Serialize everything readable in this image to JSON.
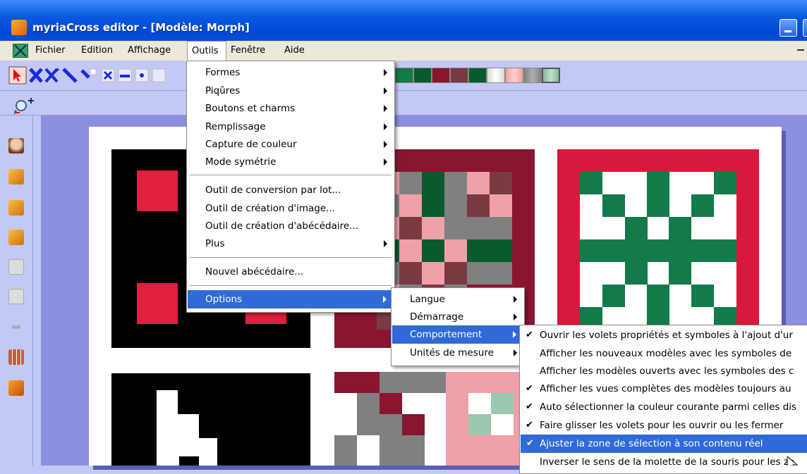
{
  "window": {
    "title": "myriaCross editor - [Modèle: Morph]"
  },
  "menubar": {
    "items": [
      "Fichier",
      "Edition",
      "Affichage",
      "Outils",
      "Fenêtre",
      "Aide"
    ]
  },
  "colors": {
    "title_bar": "#0a5ae0",
    "menu_highlight": "#2f6ad6",
    "workspace": "#8a8fe0",
    "palette": [
      "#f0f0f0",
      "#137a4a",
      "#d8183c",
      "#0a5a30",
      "#8a1530",
      "#7a3a44",
      "#0a5a30",
      "#d8d8d8",
      "#f0a0a0",
      "#808080",
      "#80b898"
    ]
  },
  "outils_menu": {
    "groups": [
      [
        {
          "label": "Formes",
          "submenu": true
        },
        {
          "label": "Piqûres",
          "submenu": true
        },
        {
          "label": "Boutons et charms",
          "submenu": true
        },
        {
          "label": "Remplissage",
          "submenu": true
        },
        {
          "label": "Capture de couleur",
          "submenu": true
        },
        {
          "label": "Mode symétrie",
          "submenu": true
        }
      ],
      [
        {
          "label": "Outil de conversion par lot...",
          "submenu": false
        },
        {
          "label": "Outil de création d'image...",
          "submenu": false
        },
        {
          "label": "Outil de création d'abécédaire...",
          "submenu": false
        },
        {
          "label": "Plus",
          "submenu": true
        }
      ],
      [
        {
          "label": "Nouvel abécédaire...",
          "submenu": false
        }
      ],
      [
        {
          "label": "Options",
          "submenu": true,
          "highlighted": true
        }
      ]
    ]
  },
  "options_menu": {
    "items": [
      {
        "label": "Langue",
        "highlighted": false
      },
      {
        "label": "Démarrage",
        "highlighted": false
      },
      {
        "label": "Comportement",
        "highlighted": true
      },
      {
        "label": "Unités de mesure",
        "highlighted": false
      }
    ]
  },
  "comportement_menu": {
    "items": [
      {
        "label": "Ouvrir les volets propriétés et symboles à l'ajout d'ur",
        "checked": true,
        "highlighted": false
      },
      {
        "label": "Afficher les nouveaux modèles avec les symboles de",
        "checked": false,
        "highlighted": false
      },
      {
        "label": "Afficher les modèles ouverts avec les symboles des c",
        "checked": false,
        "highlighted": false
      },
      {
        "label": "Afficher les vues complètes des modèles toujours au",
        "checked": true,
        "highlighted": false
      },
      {
        "label": "Auto sélectionner la couleur courante parmi celles dis",
        "checked": true,
        "highlighted": false
      },
      {
        "label": "Faire glisser les volets pour les ouvrir ou les fermer",
        "checked": true,
        "highlighted": false
      },
      {
        "label": "Ajuster la zone de sélection à son contenu réel",
        "checked": true,
        "highlighted": true
      },
      {
        "label": "Inverser le sens de la molette de la souris pour les zo",
        "checked": false,
        "highlighted": false
      }
    ]
  },
  "icons": [
    "pointer-icon",
    "cross-stitch-icon",
    "double-cross-icon",
    "backstitch-icon",
    "half-stitch-icon",
    "small-cross-icon",
    "dash-icon",
    "dot-icon",
    "zoom-in-icon",
    "face-icon",
    "check-doc-icon",
    "copy-doc-icon",
    "search-doc-icon",
    "clipboard-icon",
    "paste-icon",
    "redo-icon",
    "pattern-grid-icon",
    "cube-icon"
  ]
}
